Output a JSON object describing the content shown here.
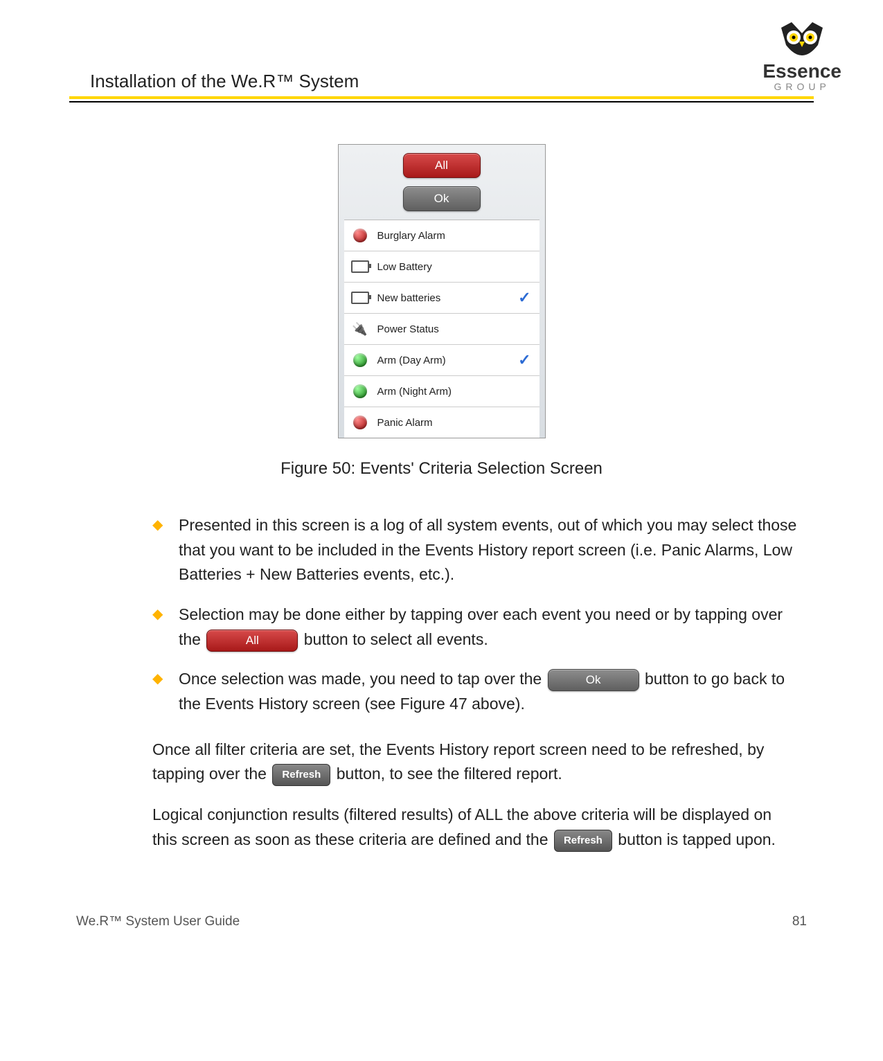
{
  "header": {
    "title": "Installation of the We.R™ System"
  },
  "logo": {
    "name": "Essence",
    "sub": "GROUP"
  },
  "figure": {
    "buttons": {
      "all": "All",
      "ok": "Ok"
    },
    "rows": [
      {
        "label": "Burglary Alarm",
        "icon": "dot-red",
        "checked": false
      },
      {
        "label": "Low Battery",
        "icon": "batt-low",
        "checked": false
      },
      {
        "label": "New batteries",
        "icon": "batt-full",
        "checked": true
      },
      {
        "label": "Power Status",
        "icon": "plug",
        "checked": false
      },
      {
        "label": "Arm (Day Arm)",
        "icon": "dot-green",
        "checked": true
      },
      {
        "label": "Arm (Night Arm)",
        "icon": "dot-green",
        "checked": false
      },
      {
        "label": "Panic Alarm",
        "icon": "dot-red",
        "checked": false
      }
    ],
    "caption": "Figure 50: Events' Criteria Selection Screen"
  },
  "bullets": {
    "b1": "Presented in this screen is a log of all system events, out of which you may select those that you want to be included in the Events History report screen (i.e. Panic Alarms, Low Batteries + New Batteries events, etc.).",
    "b2a": "Selection may be done either by tapping over each event you need or by tapping over the ",
    "b2b": " button to select all events.",
    "b3a": "Once selection was made, you need to tap over the ",
    "b3b": " button to go back to the Events History screen (see Figure 47 above)."
  },
  "para": {
    "p1a": "Once all filter criteria are set, the Events History report screen need to be refreshed, by tapping over the ",
    "p1b": " button, to see the filtered report.",
    "p2a": "Logical conjunction results (filtered results) of ALL the above criteria will be displayed on this screen as soon as these criteria are defined and the ",
    "p2b": " button is tapped upon."
  },
  "inline": {
    "all": "All",
    "ok": "Ok",
    "refresh": "Refresh"
  },
  "footer": {
    "left": "We.R™ System User Guide",
    "page": "81"
  }
}
